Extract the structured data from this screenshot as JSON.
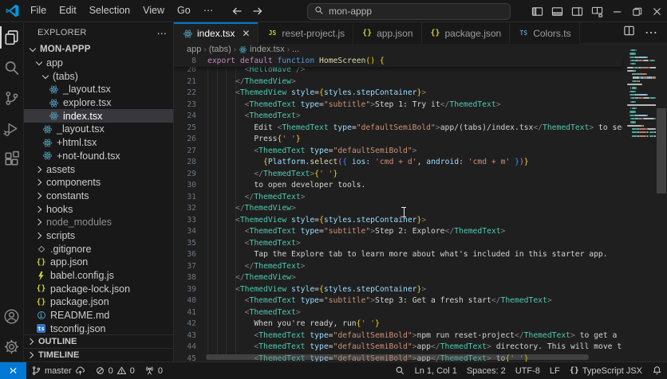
{
  "colors": {
    "accent": "#0078d4",
    "editor_bg": "#1f1f1f",
    "shell_bg": "#181818",
    "selection_bg": "#37373d"
  },
  "titlebar": {
    "menus": [
      "File",
      "Edit",
      "Selection",
      "View",
      "Go",
      "⋯"
    ],
    "search_value": "mon-appp",
    "nav_icons": [
      "arrow-left",
      "arrow-right"
    ],
    "window_icons": [
      "layout-sidebar-left",
      "layout-panel",
      "layout-sidebar-right",
      "layout-customize",
      "minimize",
      "restore",
      "close"
    ]
  },
  "activity_bar": {
    "top": [
      {
        "icon": "files",
        "active": true
      },
      {
        "icon": "search",
        "active": false
      },
      {
        "icon": "source-control",
        "active": false
      },
      {
        "icon": "run-debug",
        "active": false
      },
      {
        "icon": "extensions",
        "active": false
      }
    ],
    "bottom": [
      {
        "icon": "account",
        "active": false
      },
      {
        "icon": "settings-gear",
        "active": false
      }
    ]
  },
  "sidebar": {
    "title": "EXPLORER",
    "actions_icon": "more-dots",
    "tree": [
      {
        "label": "MON-APPP",
        "level": 0,
        "kind": "root",
        "expanded": true
      },
      {
        "label": "app",
        "level": 1,
        "kind": "folder",
        "expanded": true
      },
      {
        "label": "(tabs)",
        "level": 2,
        "kind": "folder",
        "expanded": true
      },
      {
        "label": "_layout.tsx",
        "level": 3,
        "icon": "react"
      },
      {
        "label": "explore.tsx",
        "level": 3,
        "icon": "react"
      },
      {
        "label": "index.tsx",
        "level": 3,
        "icon": "react",
        "selected": true
      },
      {
        "label": "_layout.tsx",
        "level": 2,
        "icon": "react"
      },
      {
        "label": "+html.tsx",
        "level": 2,
        "icon": "react"
      },
      {
        "label": "+not-found.tsx",
        "level": 2,
        "icon": "react"
      },
      {
        "label": "assets",
        "level": 1,
        "kind": "folder"
      },
      {
        "label": "components",
        "level": 1,
        "kind": "folder"
      },
      {
        "label": "constants",
        "level": 1,
        "kind": "folder"
      },
      {
        "label": "hooks",
        "level": 1,
        "kind": "folder"
      },
      {
        "label": "node_modules",
        "level": 1,
        "kind": "folder",
        "dimmed": true
      },
      {
        "label": "scripts",
        "level": 1,
        "kind": "folder"
      },
      {
        "label": ".gitignore",
        "level": 1,
        "icon": "git"
      },
      {
        "label": "app.json",
        "level": 1,
        "icon": "json"
      },
      {
        "label": "babel.config.js",
        "level": 1,
        "icon": "babel"
      },
      {
        "label": "package-lock.json",
        "level": 1,
        "icon": "json"
      },
      {
        "label": "package.json",
        "level": 1,
        "icon": "json"
      },
      {
        "label": "README.md",
        "level": 1,
        "icon": "info"
      },
      {
        "label": "tsconfig.json",
        "level": 1,
        "icon": "tsconfig"
      }
    ],
    "sections": [
      "OUTLINE",
      "TIMELINE"
    ]
  },
  "tabs": [
    {
      "label": "index.tsx",
      "icon": "react",
      "active": true,
      "close": "✕"
    },
    {
      "label": "reset-project.js",
      "icon": "js",
      "active": false
    },
    {
      "label": "app.json",
      "icon": "json",
      "active": false
    },
    {
      "label": "package.json",
      "icon": "json",
      "active": false
    },
    {
      "label": "Colors.ts",
      "icon": "ts",
      "active": false
    }
  ],
  "editor_actions_icons": [
    "split-editor",
    "more-dots"
  ],
  "breadcrumb": {
    "parts": [
      "app",
      "(tabs)",
      "index.tsx",
      "..."
    ],
    "file_icon_index": 2
  },
  "editor": {
    "sticky_line": {
      "n": 8,
      "tokens": [
        [
          "export",
          "kw"
        ],
        [
          " ",
          ""
        ],
        [
          "default",
          "kw"
        ],
        [
          " ",
          ""
        ],
        [
          "function",
          "kw2"
        ],
        [
          " ",
          ""
        ],
        [
          "HomeScreen",
          "fn"
        ],
        [
          "()",
          "b1"
        ],
        [
          " ",
          ""
        ],
        [
          "{",
          "b1"
        ]
      ]
    },
    "lines": [
      {
        "n": 20,
        "tokens": [
          [
            "        ",
            ""
          ],
          [
            "<",
            "pun"
          ],
          [
            "HelloWave",
            "tag"
          ],
          [
            " />",
            "pun"
          ]
        ]
      },
      {
        "n": 21,
        "tokens": [
          [
            "      ",
            ""
          ],
          [
            "</",
            "pun"
          ],
          [
            "ThemedView",
            "tag"
          ],
          [
            ">",
            "pun"
          ]
        ]
      },
      {
        "n": 22,
        "tokens": [
          [
            "      ",
            ""
          ],
          [
            "<",
            "pun"
          ],
          [
            "ThemedView",
            "tag"
          ],
          [
            " style",
            "attr"
          ],
          [
            "=",
            "eq"
          ],
          [
            "{",
            "b1"
          ],
          [
            "styles.stepContainer",
            "var"
          ],
          [
            "}",
            "b1"
          ],
          [
            ">",
            "pun"
          ]
        ]
      },
      {
        "n": 23,
        "tokens": [
          [
            "        ",
            ""
          ],
          [
            "<",
            "pun"
          ],
          [
            "ThemedText",
            "tag"
          ],
          [
            " type",
            "attr"
          ],
          [
            "=",
            "eq"
          ],
          [
            "\"subtitle\"",
            "str"
          ],
          [
            ">",
            "pun"
          ],
          [
            "Step 1: Try it",
            "txt"
          ],
          [
            "</",
            "pun"
          ],
          [
            "ThemedText",
            "tag"
          ],
          [
            ">",
            "pun"
          ]
        ]
      },
      {
        "n": 24,
        "tokens": [
          [
            "        ",
            ""
          ],
          [
            "<",
            "pun"
          ],
          [
            "ThemedText",
            "tag"
          ],
          [
            ">",
            "pun"
          ]
        ]
      },
      {
        "n": 25,
        "tokens": [
          [
            "          Edit ",
            "txt"
          ],
          [
            "<",
            "pun"
          ],
          [
            "ThemedText",
            "tag"
          ],
          [
            " type",
            "attr"
          ],
          [
            "=",
            "eq"
          ],
          [
            "\"defaultSemiBold\"",
            "str"
          ],
          [
            ">",
            "pun"
          ],
          [
            "app/(tabs)/index.tsx",
            "txt"
          ],
          [
            "</",
            "pun"
          ],
          [
            "ThemedText",
            "tag"
          ],
          [
            ">",
            "pun"
          ],
          [
            " to see changes.",
            "txt"
          ]
        ]
      },
      {
        "n": 26,
        "tokens": [
          [
            "          Press",
            "txt"
          ],
          [
            "{",
            "b1"
          ],
          [
            "' '",
            "str"
          ],
          [
            "}",
            "b1"
          ]
        ]
      },
      {
        "n": 27,
        "tokens": [
          [
            "          ",
            "txt"
          ],
          [
            "<",
            "pun"
          ],
          [
            "ThemedText",
            "tag"
          ],
          [
            " type",
            "attr"
          ],
          [
            "=",
            "eq"
          ],
          [
            "\"defaultSemiBold\"",
            "str"
          ],
          [
            ">",
            "pun"
          ]
        ]
      },
      {
        "n": 28,
        "tokens": [
          [
            "            ",
            "txt"
          ],
          [
            "{",
            "b1"
          ],
          [
            "Platform",
            "var"
          ],
          [
            ".",
            "eq"
          ],
          [
            "select",
            "fn"
          ],
          [
            "(",
            "b2"
          ],
          [
            "{",
            "b3"
          ],
          [
            " ios",
            "var"
          ],
          [
            ":",
            "eq"
          ],
          [
            " ",
            "txt"
          ],
          [
            "'cmd + d'",
            "str"
          ],
          [
            ", ",
            "eq"
          ],
          [
            "android",
            "var"
          ],
          [
            ":",
            "eq"
          ],
          [
            " ",
            "txt"
          ],
          [
            "'cmd + m'",
            "str"
          ],
          [
            " ",
            "txt"
          ],
          [
            "}",
            "b3"
          ],
          [
            ")",
            "b2"
          ],
          [
            "}",
            "b1"
          ]
        ]
      },
      {
        "n": 29,
        "tokens": [
          [
            "          ",
            "txt"
          ],
          [
            "</",
            "pun"
          ],
          [
            "ThemedText",
            "tag"
          ],
          [
            ">",
            "pun"
          ],
          [
            "{",
            "b1"
          ],
          [
            "' '",
            "str"
          ],
          [
            "}",
            "b1"
          ]
        ]
      },
      {
        "n": 30,
        "tokens": [
          [
            "          to open developer tools.",
            "txt"
          ]
        ]
      },
      {
        "n": 31,
        "tokens": [
          [
            "        ",
            ""
          ],
          [
            "</",
            "pun"
          ],
          [
            "ThemedText",
            "tag"
          ],
          [
            ">",
            "pun"
          ]
        ]
      },
      {
        "n": 32,
        "tokens": [
          [
            "      ",
            ""
          ],
          [
            "</",
            "pun"
          ],
          [
            "ThemedView",
            "tag"
          ],
          [
            ">",
            "pun"
          ]
        ]
      },
      {
        "n": 33,
        "tokens": [
          [
            "      ",
            ""
          ],
          [
            "<",
            "pun"
          ],
          [
            "ThemedView",
            "tag"
          ],
          [
            " style",
            "attr"
          ],
          [
            "=",
            "eq"
          ],
          [
            "{",
            "b1"
          ],
          [
            "styles.stepContainer",
            "var"
          ],
          [
            "}",
            "b1"
          ],
          [
            ">",
            "pun"
          ]
        ]
      },
      {
        "n": 34,
        "tokens": [
          [
            "        ",
            ""
          ],
          [
            "<",
            "pun"
          ],
          [
            "ThemedText",
            "tag"
          ],
          [
            " type",
            "attr"
          ],
          [
            "=",
            "eq"
          ],
          [
            "\"subtitle\"",
            "str"
          ],
          [
            ">",
            "pun"
          ],
          [
            "Step 2: Explore",
            "txt"
          ],
          [
            "</",
            "pun"
          ],
          [
            "ThemedText",
            "tag"
          ],
          [
            ">",
            "pun"
          ]
        ]
      },
      {
        "n": 35,
        "tokens": [
          [
            "        ",
            ""
          ],
          [
            "<",
            "pun"
          ],
          [
            "ThemedText",
            "tag"
          ],
          [
            ">",
            "pun"
          ]
        ]
      },
      {
        "n": 36,
        "tokens": [
          [
            "          Tap the Explore tab to learn more about what's included in this starter app.",
            "txt"
          ]
        ]
      },
      {
        "n": 37,
        "tokens": [
          [
            "        ",
            ""
          ],
          [
            "</",
            "pun"
          ],
          [
            "ThemedText",
            "tag"
          ],
          [
            ">",
            "pun"
          ]
        ]
      },
      {
        "n": 38,
        "tokens": [
          [
            "      ",
            ""
          ],
          [
            "</",
            "pun"
          ],
          [
            "ThemedView",
            "tag"
          ],
          [
            ">",
            "pun"
          ]
        ]
      },
      {
        "n": 39,
        "tokens": [
          [
            "      ",
            ""
          ],
          [
            "<",
            "pun"
          ],
          [
            "ThemedView",
            "tag"
          ],
          [
            " style",
            "attr"
          ],
          [
            "=",
            "eq"
          ],
          [
            "{",
            "b1"
          ],
          [
            "styles.stepContainer",
            "var"
          ],
          [
            "}",
            "b1"
          ],
          [
            ">",
            "pun"
          ]
        ]
      },
      {
        "n": 40,
        "tokens": [
          [
            "        ",
            ""
          ],
          [
            "<",
            "pun"
          ],
          [
            "ThemedText",
            "tag"
          ],
          [
            " type",
            "attr"
          ],
          [
            "=",
            "eq"
          ],
          [
            "\"subtitle\"",
            "str"
          ],
          [
            ">",
            "pun"
          ],
          [
            "Step 3: Get a fresh start",
            "txt"
          ],
          [
            "</",
            "pun"
          ],
          [
            "ThemedText",
            "tag"
          ],
          [
            ">",
            "pun"
          ]
        ]
      },
      {
        "n": 41,
        "tokens": [
          [
            "        ",
            ""
          ],
          [
            "<",
            "pun"
          ],
          [
            "ThemedText",
            "tag"
          ],
          [
            ">",
            "pun"
          ]
        ]
      },
      {
        "n": 42,
        "tokens": [
          [
            "          When you're ready, run",
            "txt"
          ],
          [
            "{",
            "b1"
          ],
          [
            "' '",
            "str"
          ],
          [
            "}",
            "b1"
          ]
        ]
      },
      {
        "n": 43,
        "tokens": [
          [
            "          ",
            "txt"
          ],
          [
            "<",
            "pun"
          ],
          [
            "ThemedText",
            "tag"
          ],
          [
            " type",
            "attr"
          ],
          [
            "=",
            "eq"
          ],
          [
            "\"defaultSemiBold\"",
            "str"
          ],
          [
            ">",
            "pun"
          ],
          [
            "npm run reset-project",
            "txt"
          ],
          [
            "</",
            "pun"
          ],
          [
            "ThemedText",
            "tag"
          ],
          [
            ">",
            "pun"
          ],
          [
            " to get a fresh",
            "txt"
          ]
        ]
      },
      {
        "n": 44,
        "tokens": [
          [
            "          ",
            "txt"
          ],
          [
            "<",
            "pun"
          ],
          [
            "ThemedText",
            "tag"
          ],
          [
            " type",
            "attr"
          ],
          [
            "=",
            "eq"
          ],
          [
            "\"defaultSemiBold\"",
            "str"
          ],
          [
            ">",
            "pun"
          ],
          [
            "app",
            "txt"
          ],
          [
            "</",
            "pun"
          ],
          [
            "ThemedText",
            "tag"
          ],
          [
            ">",
            "pun"
          ],
          [
            " directory. This will move the",
            "txt"
          ]
        ]
      },
      {
        "n": 45,
        "tokens": [
          [
            "          ",
            "txt"
          ],
          [
            "<",
            "pun"
          ],
          [
            "ThemedText",
            "tag"
          ],
          [
            " type",
            "attr"
          ],
          [
            "=",
            "eq"
          ],
          [
            "\"defaultSemiBold\"",
            "str"
          ],
          [
            ">",
            "pun"
          ],
          [
            "app",
            "txt"
          ],
          [
            "</",
            "pun"
          ],
          [
            "ThemedText",
            "tag"
          ],
          [
            ">",
            "pun"
          ],
          [
            " to",
            "txt"
          ],
          [
            "{",
            "b1"
          ],
          [
            "' '",
            "str"
          ],
          [
            "}",
            "b1"
          ]
        ]
      }
    ]
  },
  "statusbar": {
    "branch": "master",
    "errors": "0",
    "warnings": "0",
    "ports": "0",
    "line_col": "Ln 1, Col 1",
    "indentation": "Spaces: 2",
    "encoding": "UTF-8",
    "eol": "LF",
    "language": "TypeScript JSX"
  }
}
